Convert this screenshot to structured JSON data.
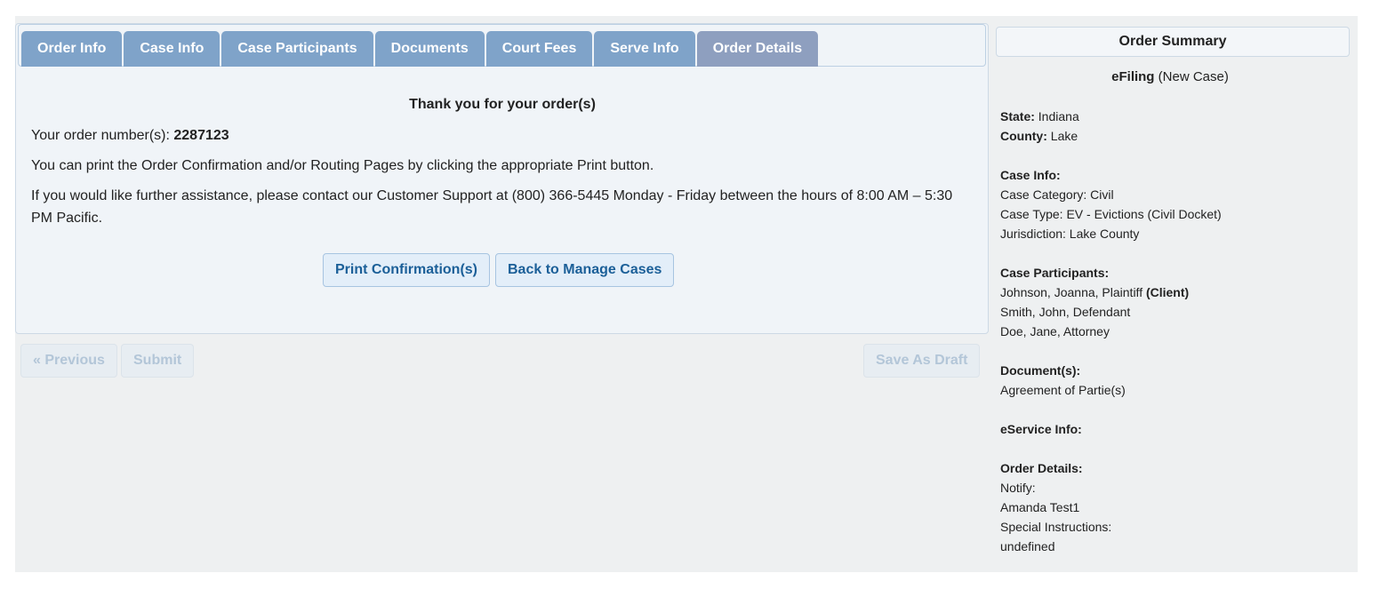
{
  "tabs": [
    {
      "label": "Order Info"
    },
    {
      "label": "Case Info"
    },
    {
      "label": "Case Participants"
    },
    {
      "label": "Documents"
    },
    {
      "label": "Court Fees"
    },
    {
      "label": "Serve Info"
    },
    {
      "label": "Order Details",
      "active": true
    }
  ],
  "confirmation": {
    "thank_you": "Thank you for your order(s)",
    "order_number_label": "Your order number(s):",
    "order_number": "2287123",
    "print_instructions": "You can print the Order Confirmation and/or Routing Pages by clicking the appropriate Print button.",
    "support_text": "If you would like further assistance, please contact our Customer Support at (800) 366-5445 Monday - Friday between the hours of 8:00 AM – 5:30 PM Pacific.",
    "print_button": "Print Confirmation(s)",
    "back_button": "Back to Manage Cases"
  },
  "footer": {
    "previous_button": "« Previous",
    "submit_button": "Submit",
    "save_draft_button": "Save As Draft"
  },
  "summary": {
    "title": "Order Summary",
    "filing_type": "eFiling",
    "filing_subtype": "(New Case)",
    "state_label": "State:",
    "state": "Indiana",
    "county_label": "County:",
    "county": "Lake",
    "case_info_label": "Case Info:",
    "case_category": "Case Category: Civil",
    "case_type": "Case Type: EV - Evictions (Civil Docket)",
    "jurisdiction": "Jurisdiction: Lake County",
    "participants_label": "Case Participants:",
    "participant_1": "Johnson, Joanna, Plaintiff",
    "participant_1_tag": "(Client)",
    "participant_2": "Smith, John, Defendant",
    "participant_3": "Doe, Jane, Attorney",
    "documents_label": "Document(s):",
    "document_1": "Agreement of Partie(s)",
    "eservice_label": "eService Info:",
    "order_details_label": "Order Details:",
    "notify": "Notify:",
    "notify_name": "Amanda Test1",
    "special_instructions": "Special Instructions:",
    "special_instructions_value": "undefined"
  }
}
